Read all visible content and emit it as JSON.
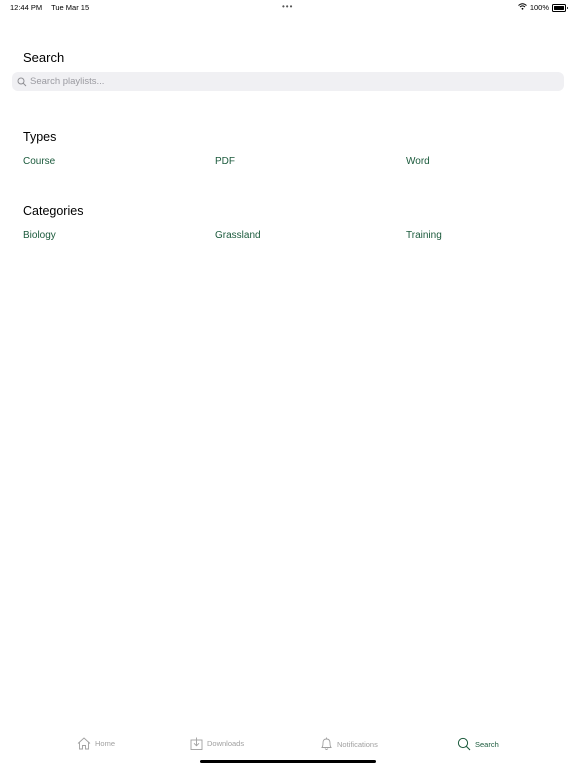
{
  "status_bar": {
    "time": "12:44 PM",
    "date": "Tue Mar 15",
    "battery": "100%"
  },
  "search": {
    "title": "Search",
    "placeholder": "Search playlists..."
  },
  "types": {
    "title": "Types",
    "items": [
      "Course",
      "PDF",
      "Word"
    ]
  },
  "categories": {
    "title": "Categories",
    "items": [
      "Biology",
      "Grassland",
      "Training"
    ]
  },
  "tab_bar": {
    "tabs": [
      {
        "label": "Home",
        "icon": "home-icon"
      },
      {
        "label": "Downloads",
        "icon": "downloads-icon"
      },
      {
        "label": "Notifications",
        "icon": "bell-icon"
      },
      {
        "label": "Search",
        "icon": "search-icon"
      }
    ],
    "active": "Search"
  },
  "colors": {
    "accent": "#1b5a3c",
    "inactive": "#a0a0a0",
    "search_bg": "#f0f0f3"
  }
}
